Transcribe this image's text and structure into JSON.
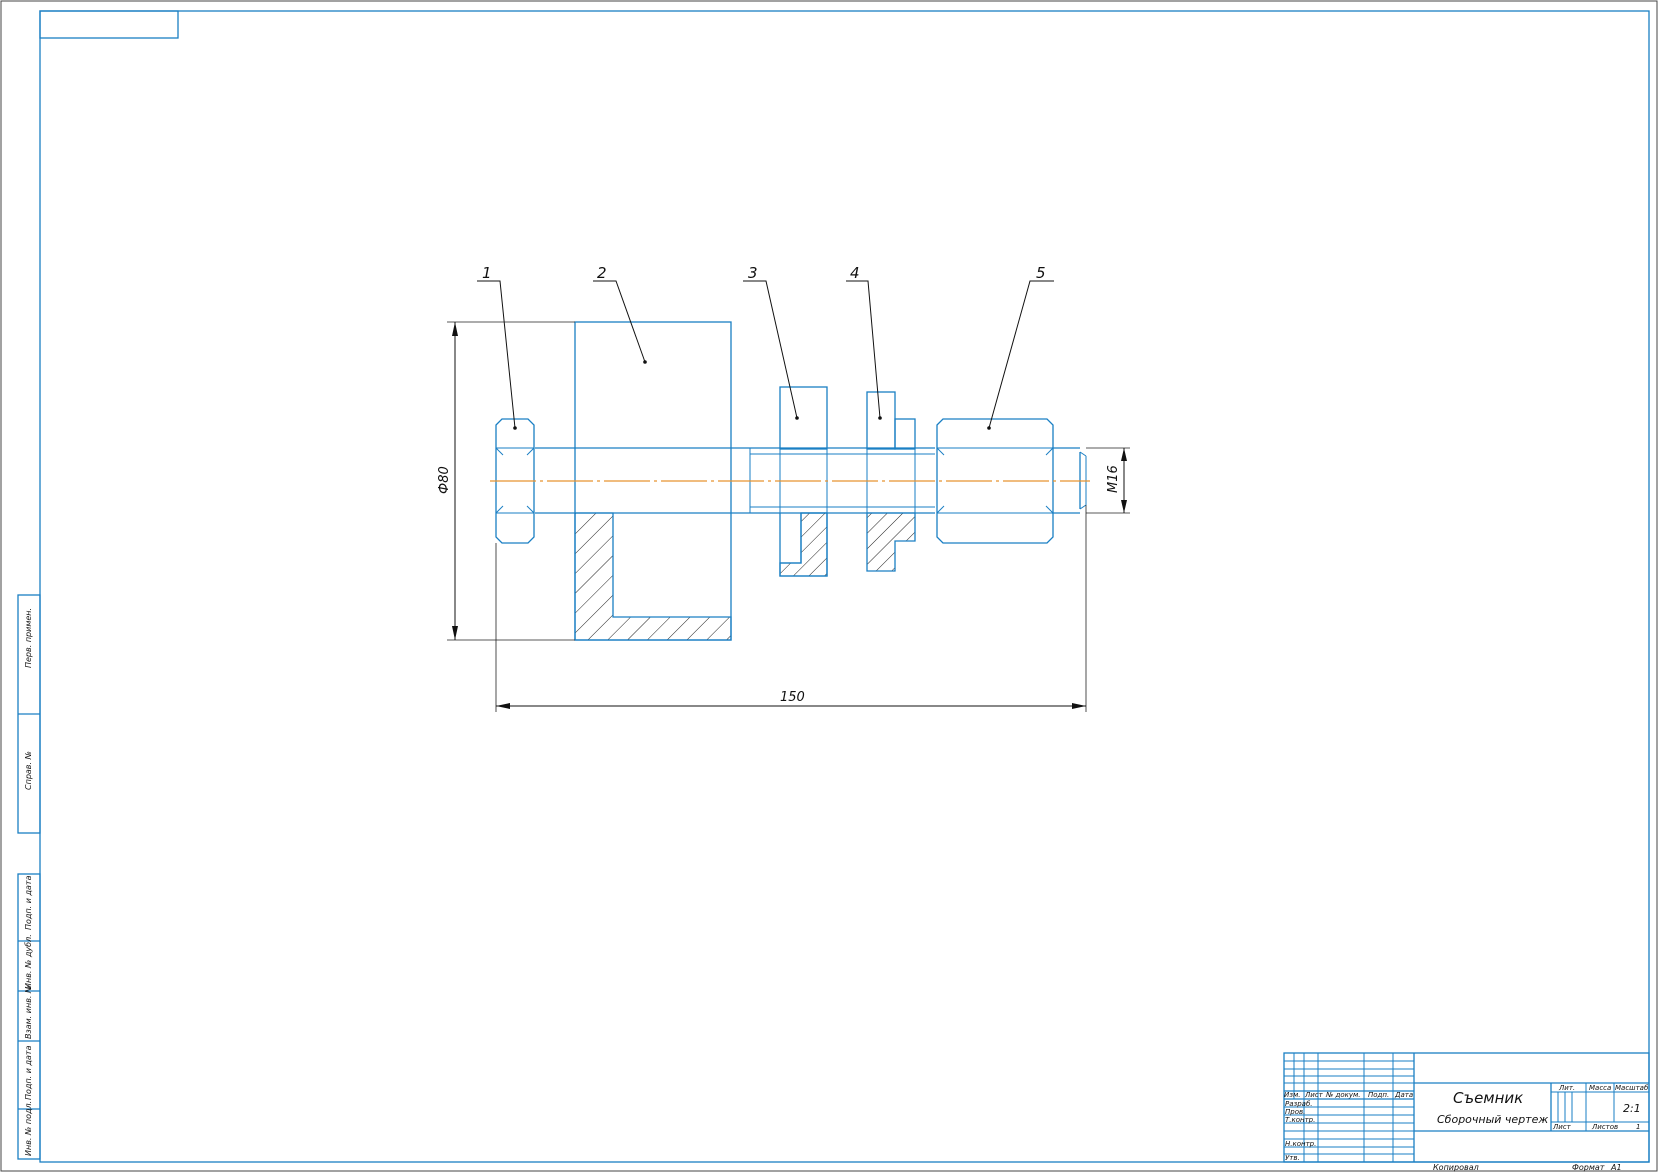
{
  "drawing": {
    "positions": [
      "1",
      "2",
      "3",
      "4",
      "5"
    ],
    "dimensions": {
      "diameter": "Ф80",
      "length": "150",
      "thread": "М16"
    }
  },
  "side_stamp": [
    "Перв. примен.",
    "Справ. №",
    "Подп. и дата",
    "Инв. № дубл.",
    "Взам. инв. №",
    "Подп. и дата",
    "Инв. № подл."
  ],
  "title_block": {
    "title": "Съемник",
    "subtitle": "Сборочный чертеж",
    "scale": "2:1",
    "col_headers": [
      "Изм.",
      "Лист",
      "№ докум.",
      "Подп.",
      "Дата"
    ],
    "role_labels": [
      "Разраб.",
      "Пров.",
      "Т.контр.",
      "Н.контр.",
      "Утв."
    ],
    "right_headers": [
      "Лит.",
      "Масса",
      "Масштаб"
    ],
    "sheet_label": "Лист",
    "sheets_label": "Листов",
    "sheets_value": "1",
    "copied_label": "Копировал",
    "format_label": "Формат",
    "format_value": "А1"
  },
  "colors": {
    "contour": "#1a7fc4",
    "axis": "#e69332",
    "dimension": "#111111"
  }
}
